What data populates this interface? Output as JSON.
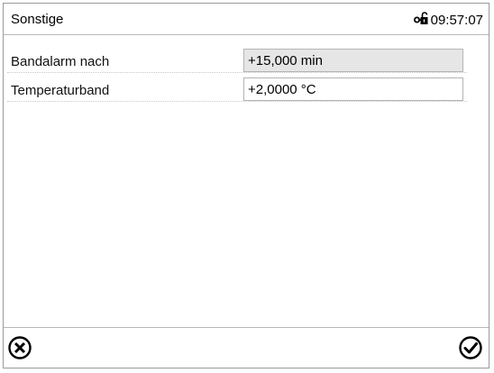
{
  "header": {
    "title": "Sonstige",
    "time": "09:57:07",
    "lock_icon": "unlocked-key-icon"
  },
  "settings": [
    {
      "label": "Bandalarm nach",
      "value": "+15,000 min",
      "editable": false
    },
    {
      "label": "Temperaturband",
      "value": "+2,0000 °C",
      "editable": true
    }
  ],
  "footer": {
    "cancel_icon": "cancel-circle-x-icon",
    "confirm_icon": "confirm-check-circle-icon"
  }
}
